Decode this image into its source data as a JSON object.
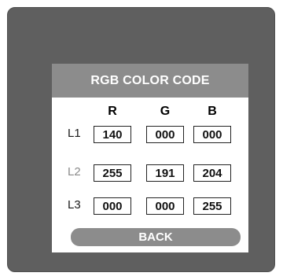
{
  "dialog": {
    "title": "RGB COLOR CODE",
    "columns": [
      "R",
      "G",
      "B"
    ],
    "rows": [
      {
        "label": "L1",
        "r": "140",
        "g": "000",
        "b": "000"
      },
      {
        "label": "L2",
        "r": "255",
        "g": "191",
        "b": "204"
      },
      {
        "label": "L3",
        "r": "000",
        "g": "000",
        "b": "255"
      }
    ],
    "back_label": "BACK"
  },
  "colors": {
    "frame": "#5f5f5f",
    "header_bg": "#8c8c8c",
    "button_bg": "#8c8c8c",
    "panel_bg": "#ffffff"
  }
}
